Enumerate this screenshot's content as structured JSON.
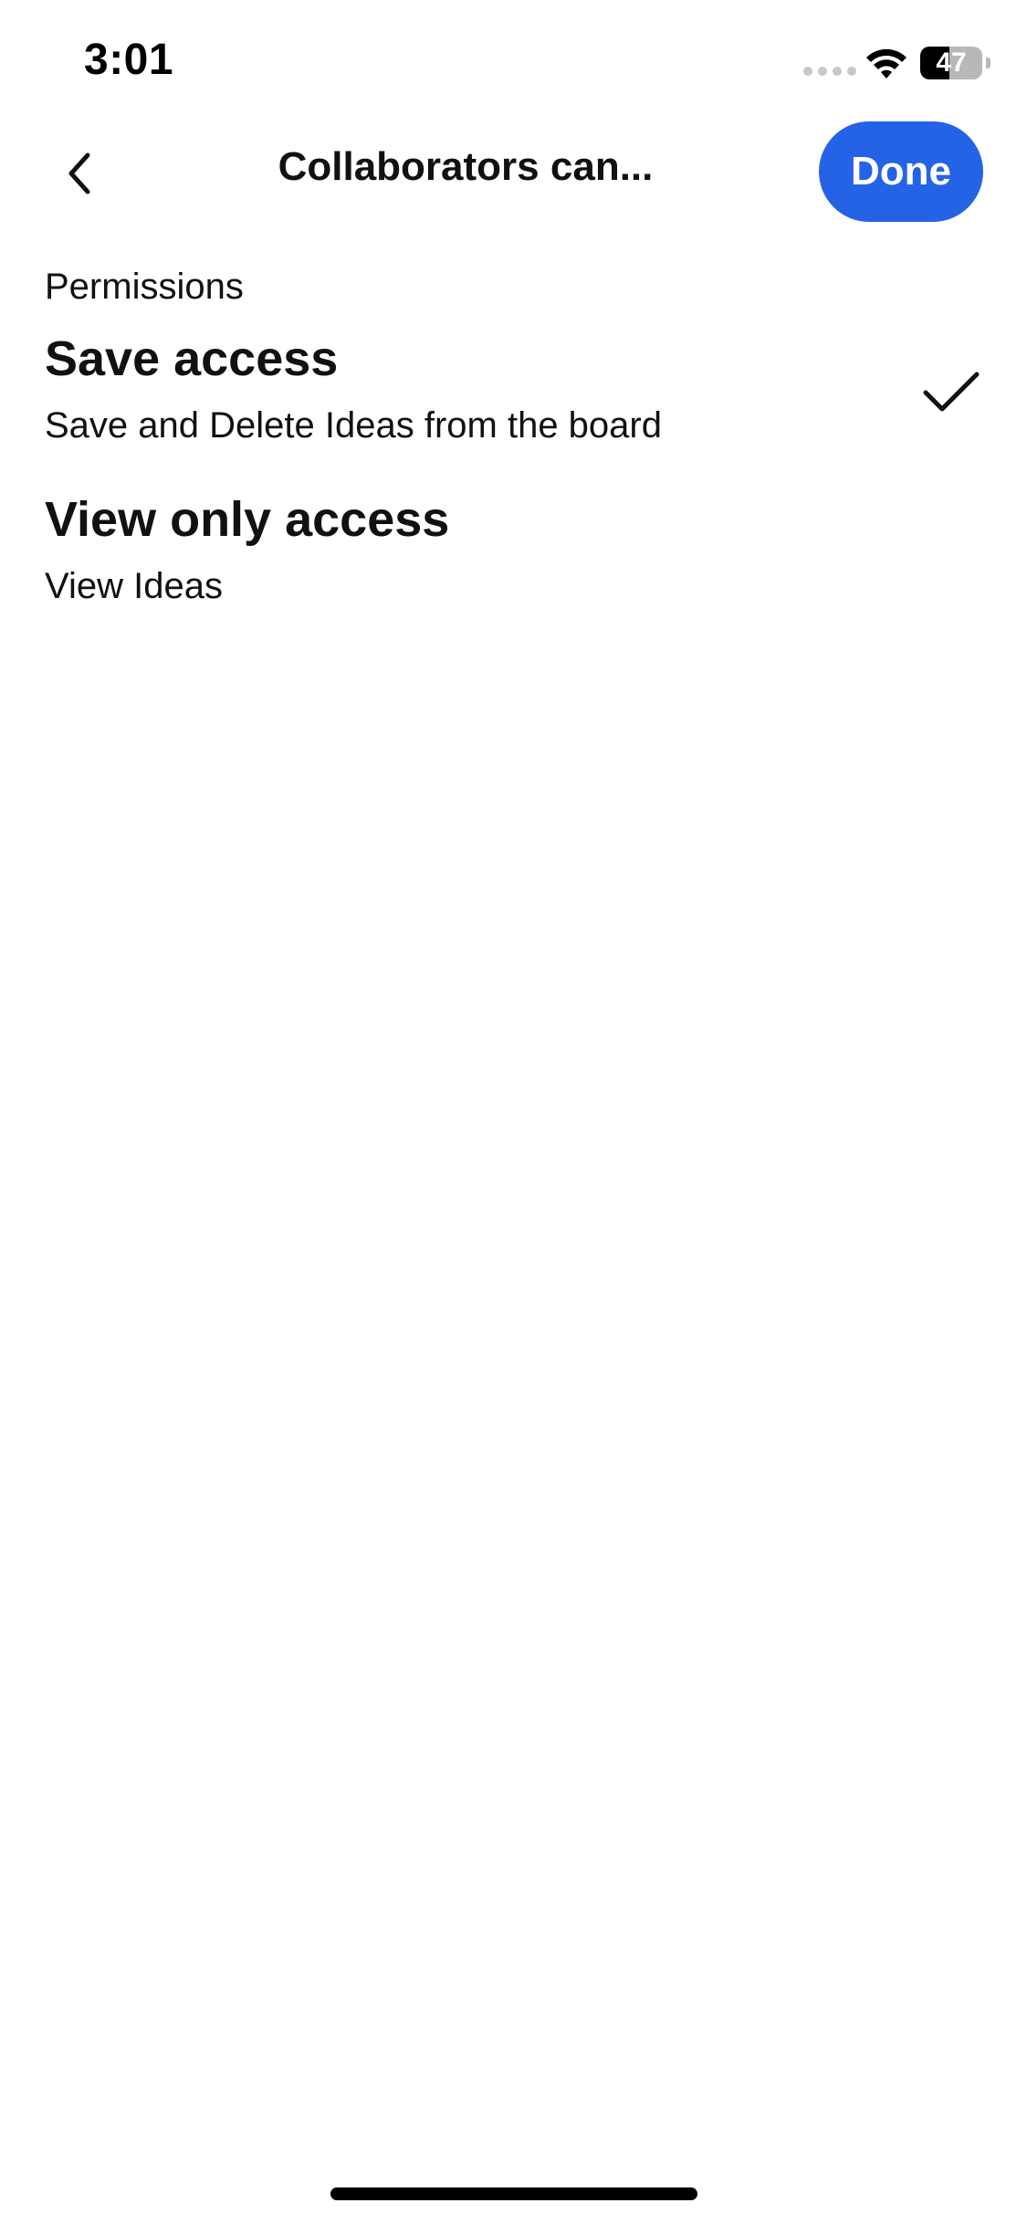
{
  "status_bar": {
    "time": "3:01",
    "battery_level": "47",
    "battery_fraction": 0.47,
    "icons": [
      "signal-dots-icon",
      "wifi-icon",
      "battery-icon"
    ]
  },
  "nav": {
    "title": "Collaborators can...",
    "done_label": "Done",
    "back_icon": "chevron-left-icon",
    "accent_color": "#2563e6"
  },
  "permissions": {
    "section_label": "Permissions",
    "options": [
      {
        "title": "Save access",
        "description": "Save and Delete Ideas from the board",
        "selected": true
      },
      {
        "title": "View only access",
        "description": "View Ideas",
        "selected": false
      }
    ]
  }
}
